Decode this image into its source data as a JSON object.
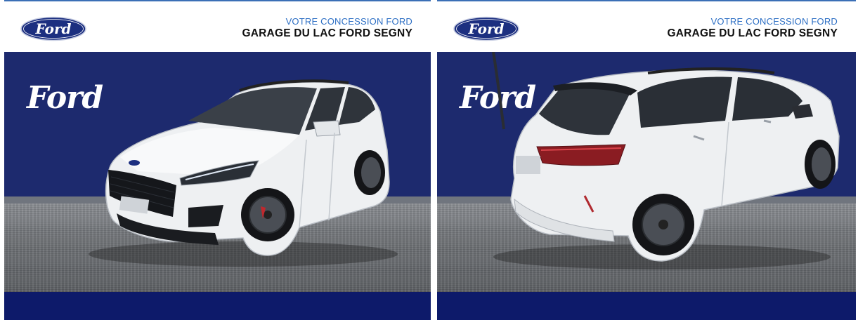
{
  "dealer": {
    "line1": "VOTRE CONCESSION FORD",
    "line2": "GARAGE DU LAC FORD SEGNY"
  },
  "brand": {
    "oval_text": "Ford",
    "wall_logo": "Ford",
    "oval_color": "#1c2f80",
    "backdrop_color": "#1d2a6e",
    "bottom_band_color": "#0d1a6a",
    "accent_color": "#2d6fc4"
  },
  "photos": [
    {
      "view": "front three-quarter",
      "car_color": "white"
    },
    {
      "view": "rear three-quarter",
      "car_color": "white"
    }
  ]
}
